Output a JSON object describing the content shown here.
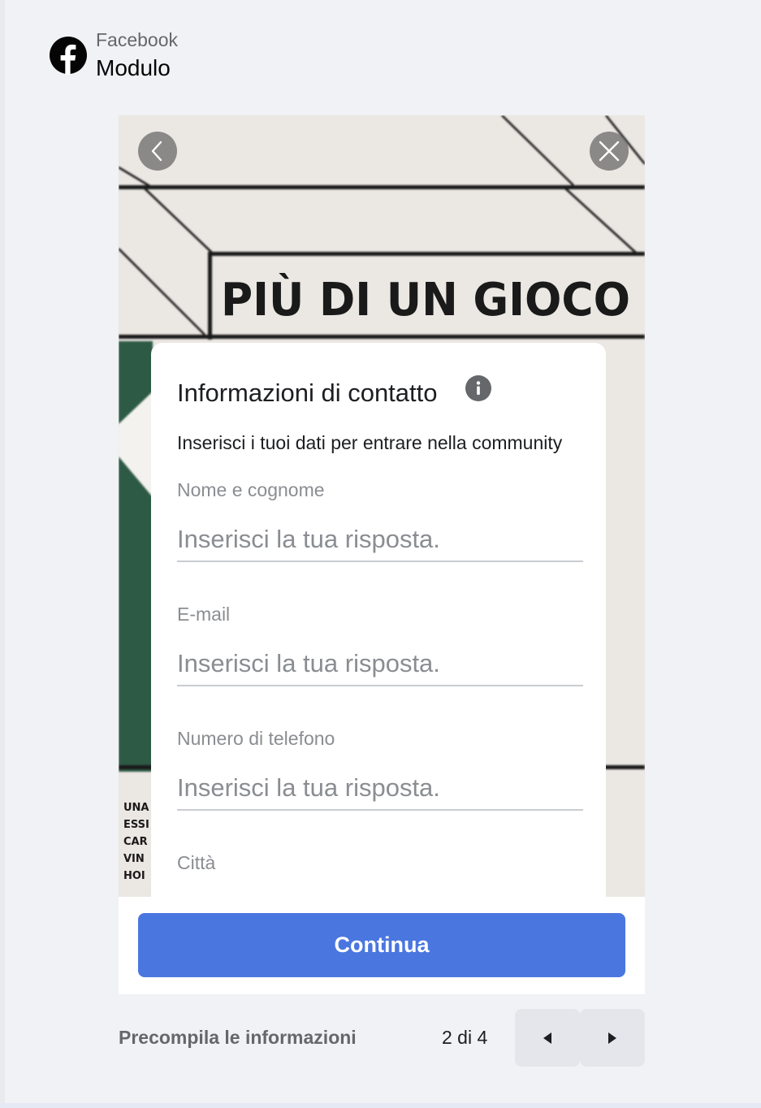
{
  "header": {
    "app_name": "Facebook",
    "title": "Modulo"
  },
  "preview": {
    "banner_text": "PIÙ DI UN GIOCO",
    "side_text": [
      "UNA",
      "ESSI",
      "CAR",
      "VIN",
      "HOI"
    ],
    "back_icon": "chevron-left-icon",
    "close_icon": "close-icon"
  },
  "form": {
    "title": "Informazioni di contatto",
    "info_icon": "info-icon",
    "description": "Inserisci i tuoi dati per entrare nella community",
    "fields": [
      {
        "label": "Nome e cognome",
        "placeholder": "Inserisci la tua risposta.",
        "value": ""
      },
      {
        "label": "E-mail",
        "placeholder": "Inserisci la tua risposta.",
        "value": ""
      },
      {
        "label": "Numero di telefono",
        "placeholder": "Inserisci la tua risposta.",
        "value": ""
      },
      {
        "label": "Città"
      }
    ]
  },
  "continue_label": "Continua",
  "footer": {
    "prefill_label": "Precompila le informazioni",
    "page_indicator": "2 di 4",
    "prev_icon": "triangle-left-icon",
    "next_icon": "triangle-right-icon"
  },
  "colors": {
    "primary_button": "#4a76df",
    "page_background": "#f0f2f5",
    "art_green": "#2d5a45"
  }
}
